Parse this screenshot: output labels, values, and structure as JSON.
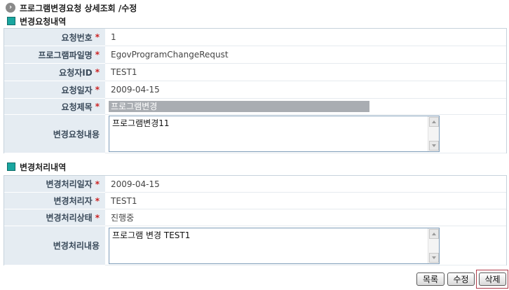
{
  "page": {
    "title": "프로그램변경요청 상세조회 /수정",
    "title_icon": "arrow-circle-icon"
  },
  "colors": {
    "label_bg": "#e5ecf2",
    "required_mark": "#cc2222",
    "section_icon": "#1aa6a0",
    "readonly_bg": "#a9adb2"
  },
  "request_section": {
    "heading": "변경요청내역",
    "icon": "teal-square-icon",
    "required_mark": "*",
    "fields": {
      "request_no": {
        "label": "요청번호",
        "value": "1"
      },
      "program_file": {
        "label": "프로그램파일명",
        "value": "EgovProgramChangeRequst"
      },
      "requester_id": {
        "label": "요청자ID",
        "value": "TEST1"
      },
      "request_date": {
        "label": "요청일자",
        "value": "2009-04-15"
      },
      "request_title": {
        "label": "요청제목",
        "value": "프로그램변경"
      },
      "request_content": {
        "label": "변경요청내용",
        "value": "프로그램변경11"
      }
    }
  },
  "process_section": {
    "heading": "변경처리내역",
    "icon": "teal-square-icon",
    "required_mark": "*",
    "fields": {
      "process_date": {
        "label": "변경처리일자",
        "value": "2009-04-15"
      },
      "processor": {
        "label": "변경처리자",
        "value": "TEST1"
      },
      "process_status": {
        "label": "변경처리상태",
        "value": "진행중"
      },
      "process_content": {
        "label": "변경처리내용",
        "value": "프로그램 변경 TEST1"
      }
    }
  },
  "buttons": {
    "list": "목록",
    "edit": "수정",
    "delete": "삭제"
  }
}
